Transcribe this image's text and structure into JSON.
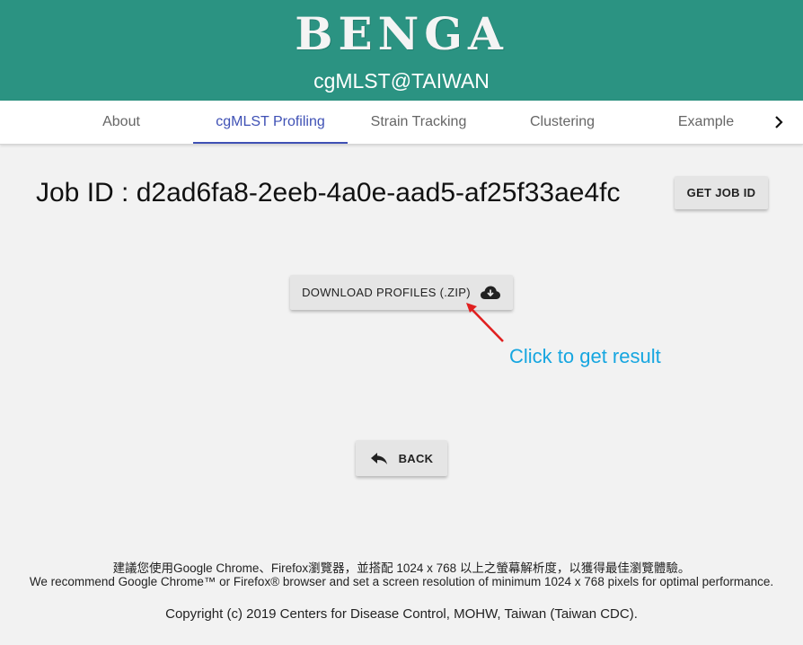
{
  "header": {
    "logo": "BENGA",
    "subtitle": "cgMLST@TAIWAN"
  },
  "tabs": [
    {
      "label": "About",
      "active": false
    },
    {
      "label": "cgMLST Profiling",
      "active": true
    },
    {
      "label": "Strain Tracking",
      "active": false
    },
    {
      "label": "Clustering",
      "active": false
    },
    {
      "label": "Example",
      "active": false
    }
  ],
  "tabs_next_icon": "chevron-right-icon",
  "job": {
    "text": "Job ID : d2ad6fa8-2eeb-4a0e-aad5-af25f33ae4fc",
    "get_job_label": "GET JOB ID"
  },
  "download": {
    "label": "DOWNLOAD PROFILES (.ZIP)",
    "icon": "cloud-download-icon"
  },
  "annotation": {
    "text": "Click to get result",
    "color": "#16a6e0",
    "arrow_color": "#e02020"
  },
  "back": {
    "label": "BACK",
    "icon": "reply-arrow-icon"
  },
  "footer": {
    "line_cn": "建議您使用Google Chrome、Firefox瀏覽器，並搭配 1024 x 768 以上之螢幕解析度，以獲得最佳瀏覽體驗。",
    "line_en": "We recommend Google Chrome™ or Firefox® browser and set a screen resolution of minimum 1024 x 768 pixels for optimal performance.",
    "copyright": "Copyright (c) 2019 Centers for Disease Control, MOHW, Taiwan (Taiwan CDC)."
  },
  "colors": {
    "header_bg": "#2b9382",
    "active_tab": "#3f51b5",
    "page_bg": "#f2f2f2"
  }
}
